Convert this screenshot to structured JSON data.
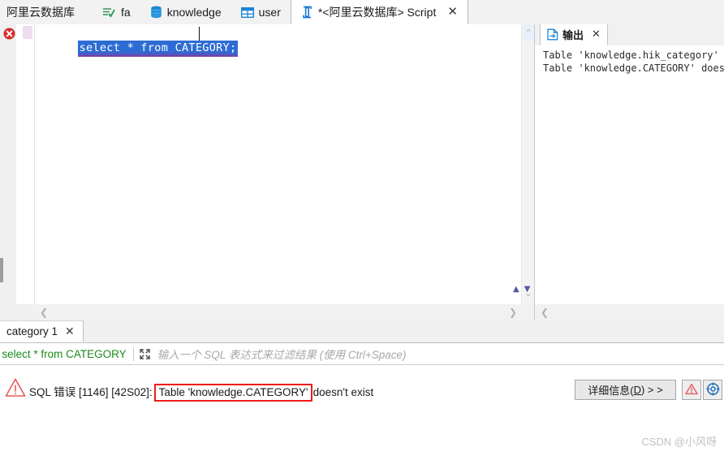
{
  "top_tabs": [
    {
      "label": "阿里云数据库",
      "icon": "",
      "active": false,
      "closable": false
    },
    {
      "label": "fa",
      "icon": "list-check-icon",
      "active": false,
      "closable": false
    },
    {
      "label": "knowledge",
      "icon": "database-icon",
      "active": false,
      "closable": false
    },
    {
      "label": "user",
      "icon": "table-icon",
      "active": false,
      "closable": false
    },
    {
      "label": "*<阿里云数据库> Script",
      "icon": "script-icon",
      "active": true,
      "closable": true,
      "close_label": "✕"
    }
  ],
  "editor": {
    "error_marker": "error-x-icon",
    "code_text": "select * from CATEGORY;",
    "selection_bg": "#2d6cd4",
    "selection_fg": "#ffffff",
    "squiggle_color": "#7a3fa8",
    "scroll_up_arrow": "⌃",
    "scroll_down_arrow": "⌄",
    "scroll_left_arrow": "❮",
    "scroll_right_arrow": "❯",
    "tri_up": "▲",
    "tri_down": "▼"
  },
  "output": {
    "tab_label": "输出",
    "tab_icon": "output-page-icon",
    "close_label": "✕",
    "lines": [
      "Table 'knowledge.hik_category' d",
      "Table 'knowledge.CATEGORY' doesn"
    ],
    "scroll_left_arrow": "❮"
  },
  "result": {
    "tab_label": "category 1",
    "close_label": "✕"
  },
  "filter": {
    "query": "' select * from CATEGORY",
    "query_color": "#1a8a1a",
    "expand_icon": "expand-arrows-icon",
    "placeholder": "输入一个 SQL 表达式来过滤结果 (使用 Ctrl+Space)"
  },
  "error": {
    "warn_icon": "warning-triangle-icon",
    "prefix": "SQL 错误 [1146] [42S02]:",
    "highlight": "Table 'knowledge.CATEGORY'",
    "suffix": "doesn't exist",
    "highlight_border": "#ee1c1c",
    "detail_button_pre": "详细信息(",
    "detail_button_key": "D",
    "detail_button_post": ") > >",
    "warn_button_icon": "warning-triangle-icon",
    "globe_button_icon": "globe-target-icon"
  },
  "watermark": "CSDN @小风呀"
}
